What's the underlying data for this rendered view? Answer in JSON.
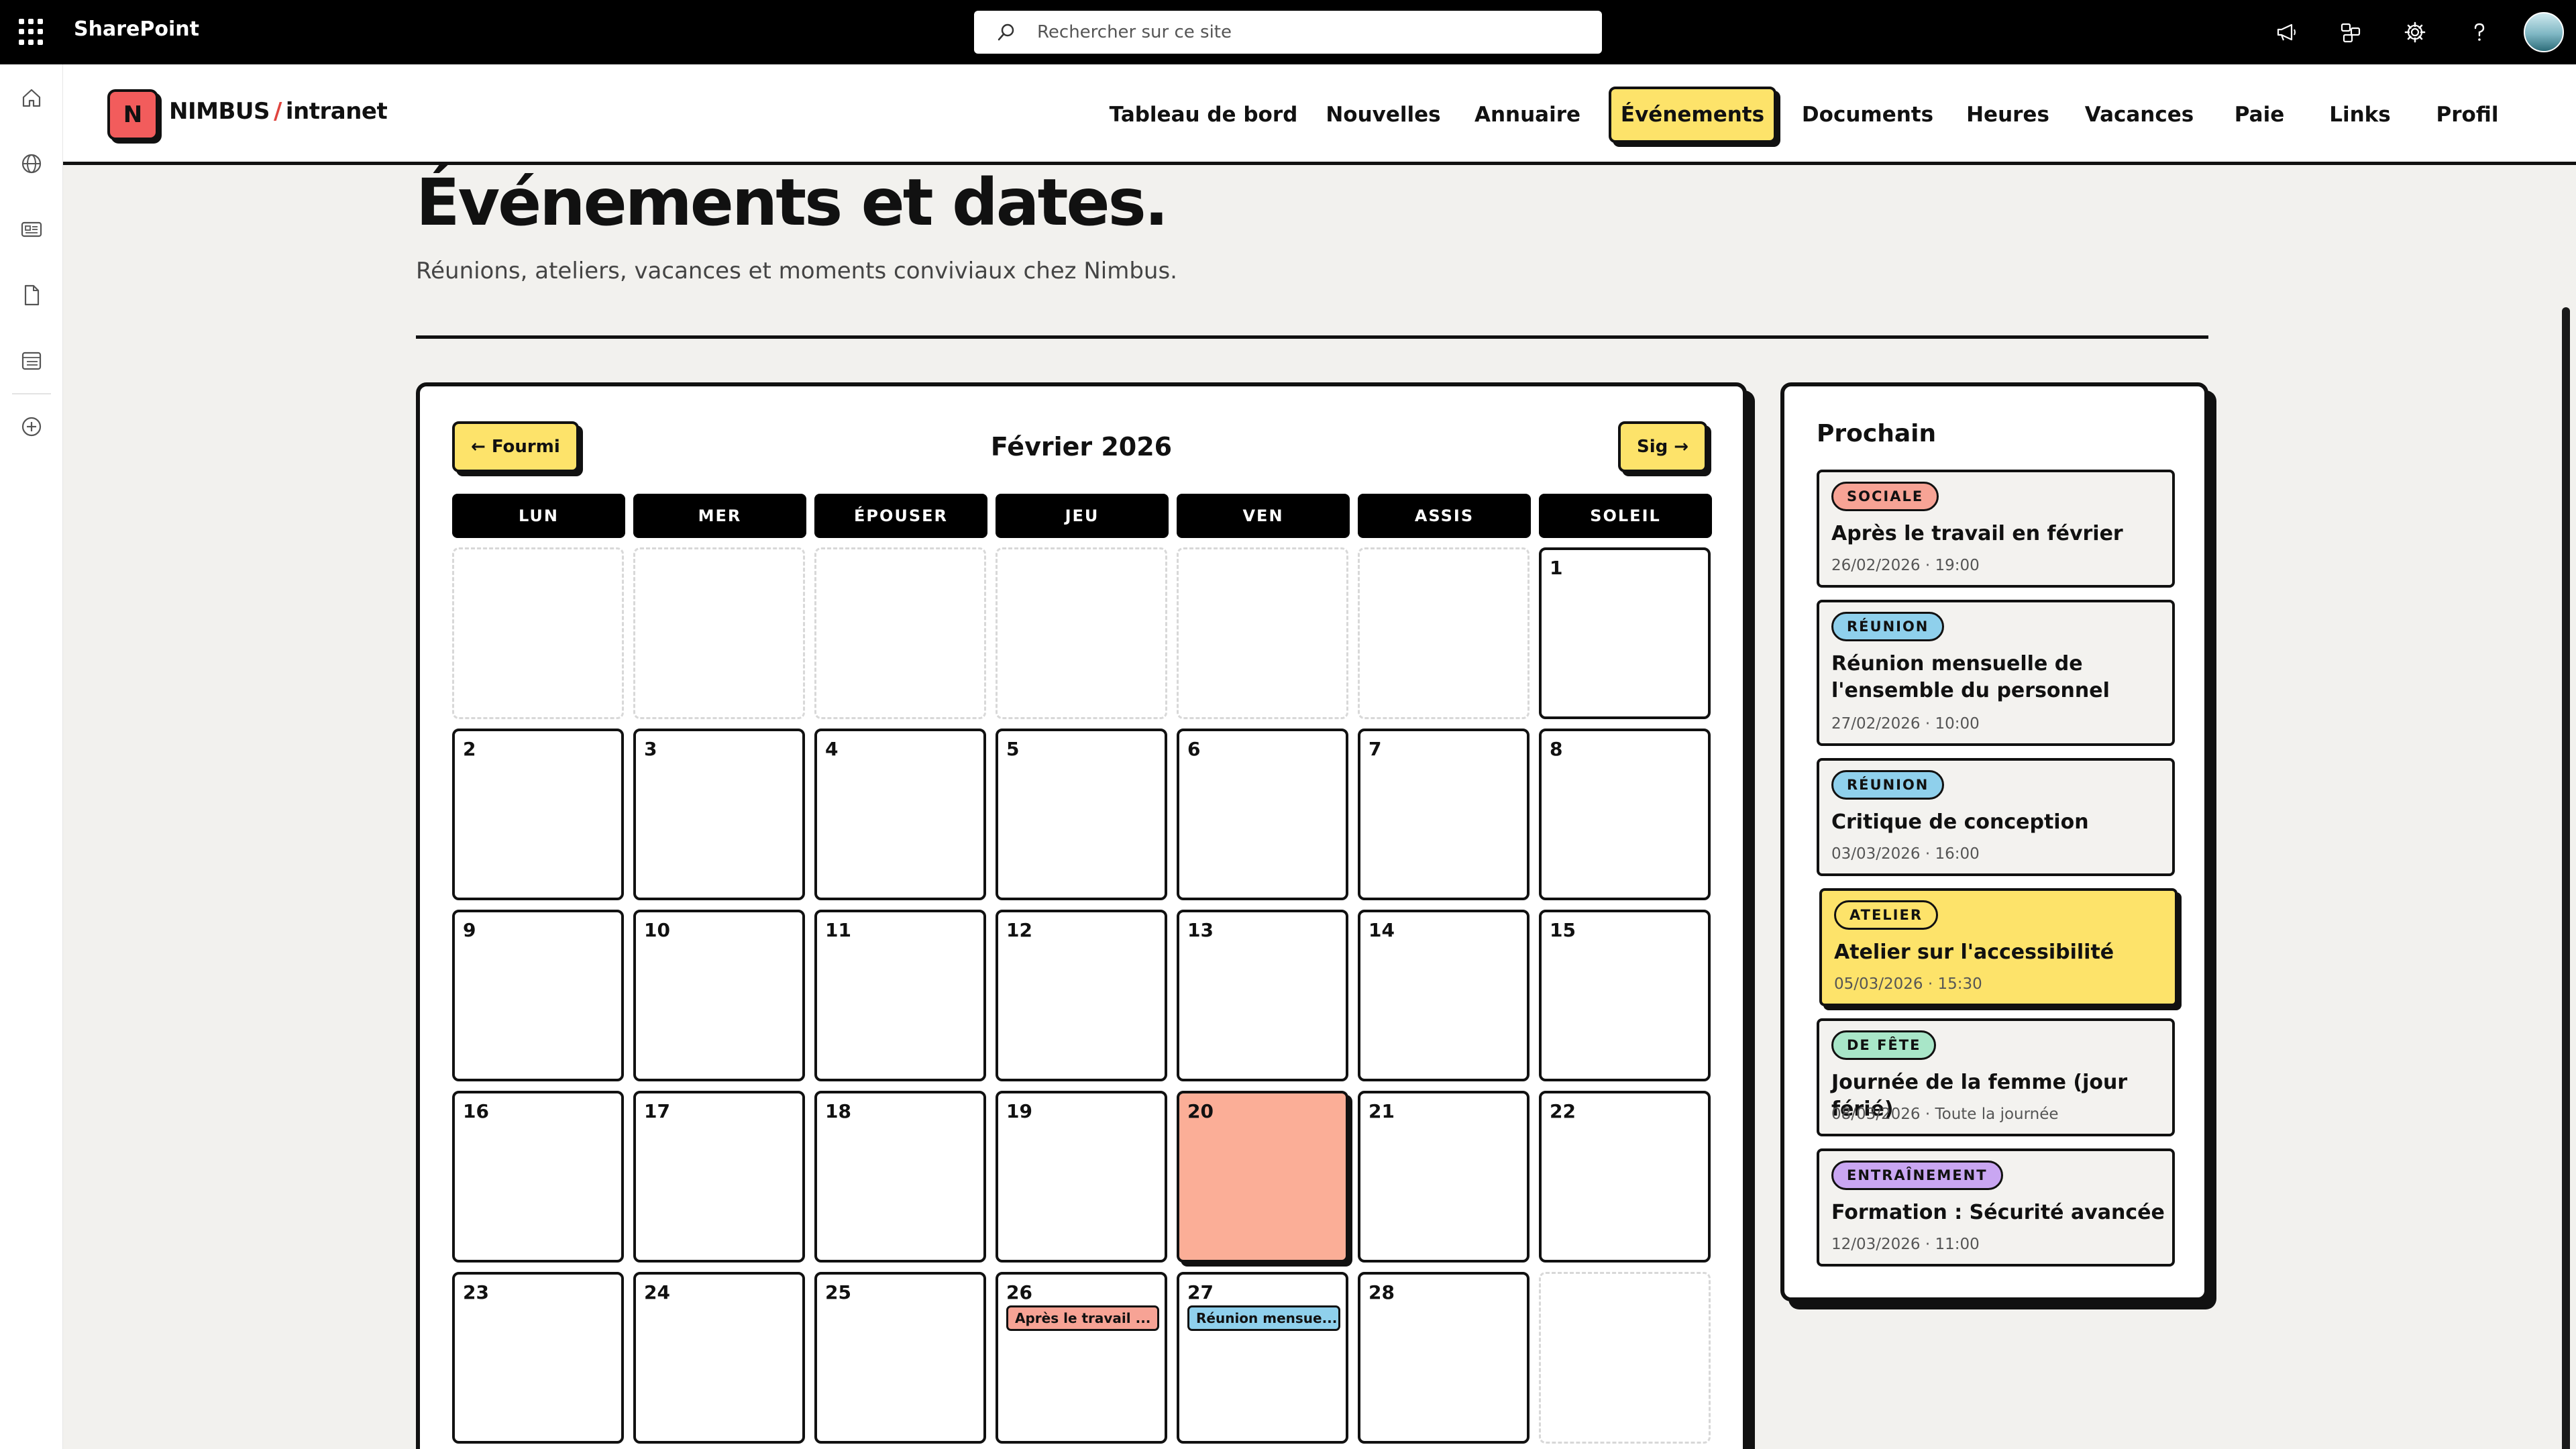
{
  "suitebar": {
    "brand": "SharePoint",
    "search_placeholder": "Rechercher sur ce site",
    "icons": [
      "megaphone-icon",
      "share-icon",
      "gear-icon",
      "help-icon"
    ]
  },
  "site": {
    "logo_letter": "N",
    "logo_name": "NIMBUS",
    "logo_slash": "/",
    "logo_sub": "intranet",
    "nav": [
      {
        "label": "Tableau de bord"
      },
      {
        "label": "Nouvelles"
      },
      {
        "label": "Annuaire"
      },
      {
        "label": "Événements",
        "active": true
      },
      {
        "label": "Documents"
      },
      {
        "label": "Heures"
      },
      {
        "label": "Vacances"
      },
      {
        "label": "Paie"
      },
      {
        "label": "Links"
      },
      {
        "label": "Profil"
      }
    ]
  },
  "page": {
    "title": "Événements et dates.",
    "subtitle": "Réunions, ateliers, vacances et moments conviviaux chez Nimbus."
  },
  "calendar": {
    "prev_label": "← Fourmi",
    "next_label": "Sig →",
    "month_title": "Février 2026",
    "weekdays": [
      "LUN",
      "MER",
      "ÉPOUSER",
      "JEU",
      "VEN",
      "ASSIS",
      "SOLEIL"
    ],
    "today": "20",
    "weeks": [
      [
        "",
        "",
        "",
        "",
        "",
        "",
        "1"
      ],
      [
        "2",
        "3",
        "4",
        "5",
        "6",
        "7",
        "8"
      ],
      [
        "9",
        "10",
        "11",
        "12",
        "13",
        "14",
        "15"
      ],
      [
        "16",
        "17",
        "18",
        "19",
        "20",
        "21",
        "22"
      ],
      [
        "23",
        "24",
        "25",
        "26",
        "27",
        "28",
        ""
      ]
    ],
    "day_events": {
      "26": {
        "label": "Après le travail ...",
        "type": "social"
      },
      "27": {
        "label": "Réunion mensue...",
        "type": "meeting"
      }
    }
  },
  "upcoming": {
    "title": "Prochain",
    "events": [
      {
        "tag": "SOCIALE",
        "tag_color": "#f7a395",
        "title": "Après le travail en février",
        "date": "26/02/2026 · 19:00"
      },
      {
        "tag": "RÉUNION",
        "tag_color": "#8fd0ec",
        "title": "Réunion mensuelle de l'ensemble du personnel",
        "date": "27/02/2026 · 10:00"
      },
      {
        "tag": "RÉUNION",
        "tag_color": "#8fd0ec",
        "title": "Critique de conception",
        "date": "03/03/2026 · 16:00"
      },
      {
        "tag": "ATELIER",
        "tag_color": "#fde36a",
        "title": "Atelier sur l'accessibilité",
        "date": "05/03/2026 · 15:30",
        "highlight": true
      },
      {
        "tag": "DE FÊTE",
        "tag_color": "#a8e6c8",
        "title": "Journée de la femme (jour férié)",
        "date": "08/03/2026 · Toute la journée"
      },
      {
        "tag": "ENTRAÎNEMENT",
        "tag_color": "#c9a6f2",
        "title": "Formation : Sécurité avancée",
        "date": "12/03/2026 · 11:00"
      }
    ]
  }
}
